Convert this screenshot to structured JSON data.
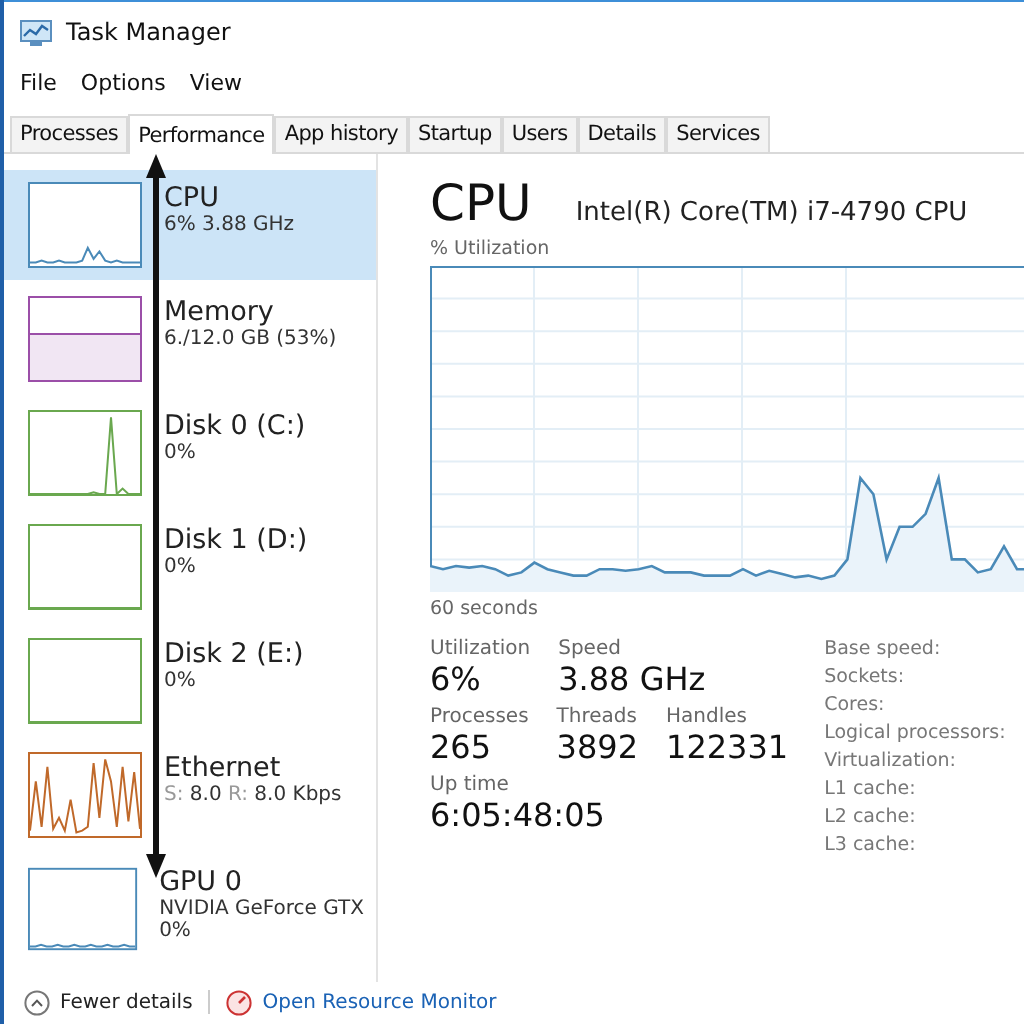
{
  "window": {
    "title": "Task Manager"
  },
  "menu": [
    "File",
    "Options",
    "View"
  ],
  "tabs": [
    {
      "label": "Processes",
      "selected": false
    },
    {
      "label": "Performance",
      "selected": true
    },
    {
      "label": "App history",
      "selected": false
    },
    {
      "label": "Startup",
      "selected": false
    },
    {
      "label": "Users",
      "selected": false
    },
    {
      "label": "Details",
      "selected": false
    },
    {
      "label": "Services",
      "selected": false
    }
  ],
  "sidebar": {
    "items": [
      {
        "kind": "cpu",
        "name": "CPU",
        "detail": "6% 3.88 GHz",
        "selected": true,
        "color": "#4a8ab8"
      },
      {
        "kind": "memory",
        "name": "Memory",
        "detail": "6./12.0 GB (53%)",
        "selected": false,
        "color": "#9b4fa8"
      },
      {
        "kind": "disk-spike",
        "name": "Disk 0 (C:)",
        "detail": "0%",
        "selected": false,
        "color": "#6aa84f"
      },
      {
        "kind": "disk",
        "name": "Disk 1 (D:)",
        "detail": "0%",
        "selected": false,
        "color": "#6aa84f"
      },
      {
        "kind": "disk",
        "name": "Disk 2 (E:)",
        "detail": "0%",
        "selected": false,
        "color": "#6aa84f"
      },
      {
        "kind": "ethernet",
        "name": "Ethernet",
        "detail_parts": [
          {
            "label": "S:",
            "value": "8.0"
          },
          {
            "label": "R:",
            "value": "8.0 Kbps"
          }
        ],
        "selected": false,
        "color": "#c0692a"
      },
      {
        "kind": "gpu",
        "name": "GPU 0",
        "detail": "NVIDIA GeForce GTX",
        "detail2": "0%",
        "selected": false,
        "color": "#4a8ab8"
      }
    ]
  },
  "main": {
    "title": "CPU",
    "model": "Intel(R) Core(TM) i7-4790 CPU",
    "chart_label": "% Utilization",
    "time_label": "60 seconds",
    "stats": [
      [
        {
          "label": "Utilization",
          "value": "6%"
        },
        {
          "label": "Speed",
          "value": "3.88 GHz"
        }
      ],
      [
        {
          "label": "Processes",
          "value": "265"
        },
        {
          "label": "Threads",
          "value": "3892"
        },
        {
          "label": "Handles",
          "value": "122331"
        }
      ],
      [
        {
          "label": "Up time",
          "value": "6:05:48:05"
        }
      ]
    ],
    "specs": [
      "Base speed:",
      "Sockets:",
      "Cores:",
      "Logical processors:",
      "Virtualization:",
      "L1 cache:",
      "L2 cache:",
      "L3 cache:"
    ]
  },
  "footer": {
    "fewer_details": "Fewer details",
    "resource_monitor": "Open Resource Monitor"
  }
}
